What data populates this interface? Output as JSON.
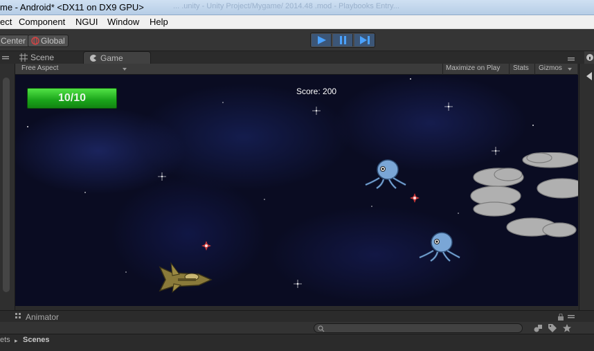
{
  "window": {
    "title": "me - Android* <DX11 on DX9 GPU>",
    "title_ghost": "... .unity - Unity Project/Mygame/ 2014.48 .mod - Playbooks Entry..."
  },
  "menu": {
    "items": [
      "ect",
      "Component",
      "NGUI",
      "Window",
      "Help"
    ]
  },
  "toolbar": {
    "pivot_center": "Center",
    "pivot_global": "Global",
    "play_icon": "play-icon",
    "pause_icon": "pause-icon",
    "step_icon": "step-icon"
  },
  "tabs": {
    "scene": "Scene",
    "game": "Game"
  },
  "game_view": {
    "aspect": "Free Aspect",
    "maximize": "Maximize on Play",
    "stats": "Stats",
    "gizmos": "Gizmos"
  },
  "game": {
    "health": "10/10",
    "score": "Score: 200"
  },
  "bottom": {
    "animator_tab": "Animator",
    "breadcrumb_prev": "ets",
    "breadcrumb_current": "Scenes"
  },
  "colors": {
    "accent_blue": "#3c5677",
    "health_green": "#1aa41a",
    "space_bg": "#0a0c22"
  }
}
